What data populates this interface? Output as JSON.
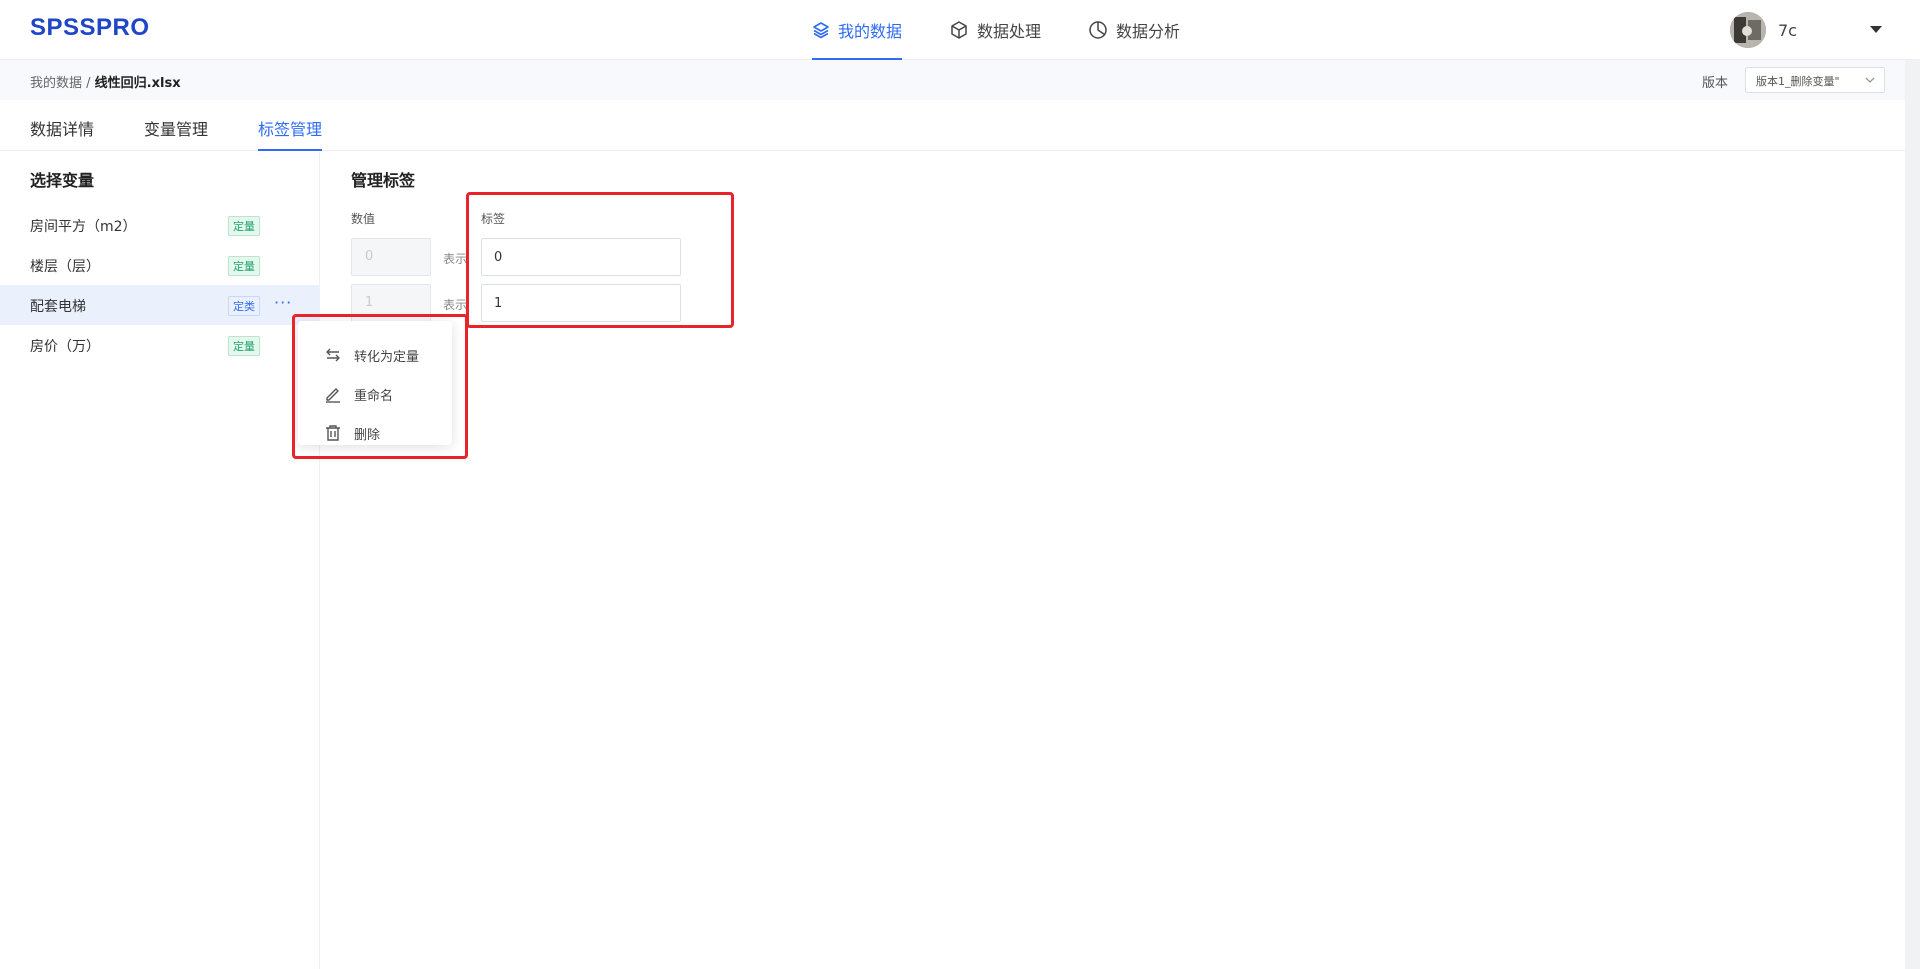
{
  "app": {
    "logo": "SPSSPRO"
  },
  "nav": [
    {
      "label": "我的数据",
      "icon": "layers-icon",
      "active": true
    },
    {
      "label": "数据处理",
      "icon": "cube-icon",
      "active": false
    },
    {
      "label": "数据分析",
      "icon": "pie-chart-icon",
      "active": false
    }
  ],
  "user": {
    "name": "7c"
  },
  "breadcrumb": {
    "root": "我的数据",
    "separator": " / ",
    "file": "线性回归.xlsx"
  },
  "version": {
    "label": "版本",
    "selected": "版本1_删除变量\""
  },
  "tabs": [
    {
      "label": "数据详情",
      "active": false
    },
    {
      "label": "变量管理",
      "active": false
    },
    {
      "label": "标签管理",
      "active": true
    }
  ],
  "sidebar": {
    "title": "选择变量",
    "variables": [
      {
        "name": "房间平方（m2）",
        "type": "定量",
        "selected": false
      },
      {
        "name": "楼层（层）",
        "type": "定量",
        "selected": false
      },
      {
        "name": "配套电梯",
        "type": "定类",
        "selected": true
      },
      {
        "name": "房价（万）",
        "type": "定量",
        "selected": false
      }
    ],
    "more": "···"
  },
  "context_menu": {
    "items": [
      {
        "label": "转化为定量",
        "icon": "swap-arrows-icon"
      },
      {
        "label": "重命名",
        "icon": "pencil-icon"
      },
      {
        "label": "删除",
        "icon": "trash-icon"
      }
    ]
  },
  "main": {
    "title": "管理标签",
    "value_header": "数值",
    "label_header": "标签",
    "rows": [
      {
        "value": "0",
        "represents": "表示",
        "label": "0"
      },
      {
        "value": "1",
        "represents": "表示",
        "label": "1"
      }
    ]
  },
  "colors": {
    "accent": "#2f6bf5",
    "highlight": "#e8232a",
    "quantitative": "#19a46b"
  }
}
